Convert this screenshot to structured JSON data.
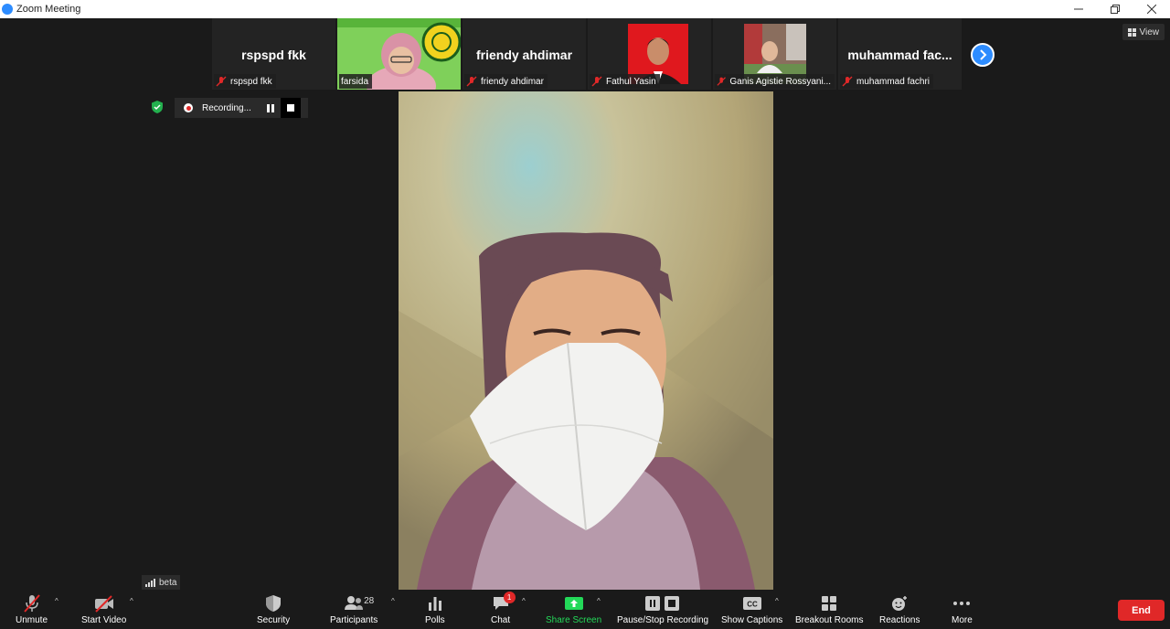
{
  "window": {
    "title": "Zoom Meeting"
  },
  "strip": {
    "thumbs": [
      {
        "display": "rspspd fkk",
        "tag": "rspspd fkk",
        "type": "name"
      },
      {
        "tag": "farsida",
        "type": "video"
      },
      {
        "display": "friendy ahdimar",
        "tag": "friendy ahdimar",
        "type": "name"
      },
      {
        "tag": "Fathul Yasin",
        "type": "video"
      },
      {
        "tag": "Ganis Agistie Rossyani...",
        "type": "video"
      },
      {
        "display": "muhammad  fac...",
        "tag": "muhammad fachri",
        "type": "name"
      }
    ]
  },
  "view_button": {
    "label": "View"
  },
  "recording": {
    "label": "Recording..."
  },
  "beta": {
    "label": "beta"
  },
  "toolbar": {
    "unmute": "Unmute",
    "start_video": "Start Video",
    "security": "Security",
    "participants": "Participants",
    "participant_count": "28",
    "polls": "Polls",
    "chat": "Chat",
    "chat_badge": "1",
    "share_screen": "Share Screen",
    "recording": "Pause/Stop Recording",
    "captions": "Show Captions",
    "captions_icon": "CC",
    "breakout": "Breakout Rooms",
    "reactions": "Reactions",
    "more": "More",
    "end": "End"
  },
  "colors": {
    "accent": "#2d8cff",
    "end": "#e02828",
    "share": "#23d959"
  }
}
